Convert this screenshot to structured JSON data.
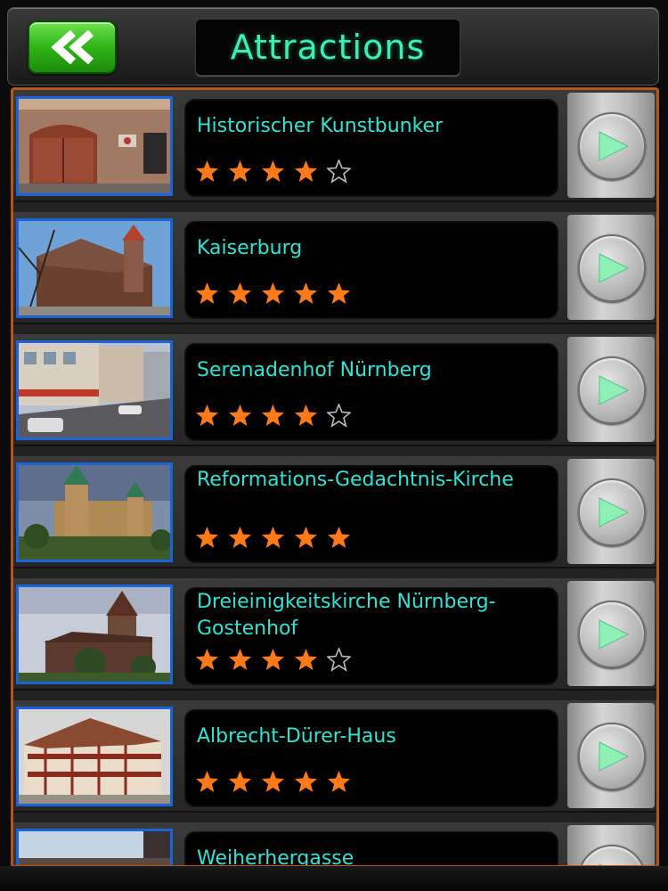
{
  "header": {
    "title": "Attractions",
    "back_icon": "double-chevron-left-icon"
  },
  "colors": {
    "accent_text": "#36e2d4",
    "title_text": "#3cf0b4",
    "star_filled": "#ff7a1a",
    "frame_border": "#b5551b",
    "thumb_border": "#1a63d8",
    "back_button": "#2fb417",
    "play_arrow": "#8ff0b6"
  },
  "attractions": [
    {
      "name": "Historischer Kunstbunker",
      "rating": 4,
      "rating_max": 5
    },
    {
      "name": "Kaiserburg",
      "rating": 5,
      "rating_max": 5
    },
    {
      "name": "Serenadenhof Nürnberg",
      "rating": 4,
      "rating_max": 5
    },
    {
      "name": "Reformations-Gedachtnis-Kirche",
      "rating": 5,
      "rating_max": 5
    },
    {
      "name": "Dreieinigkeitskirche Nürnberg-Gostenhof",
      "rating": 4,
      "rating_max": 5
    },
    {
      "name": "Albrecht-Dürer-Haus",
      "rating": 5,
      "rating_max": 5
    },
    {
      "name": "Weiherhergasse",
      "rating": null,
      "rating_max": 5
    }
  ]
}
